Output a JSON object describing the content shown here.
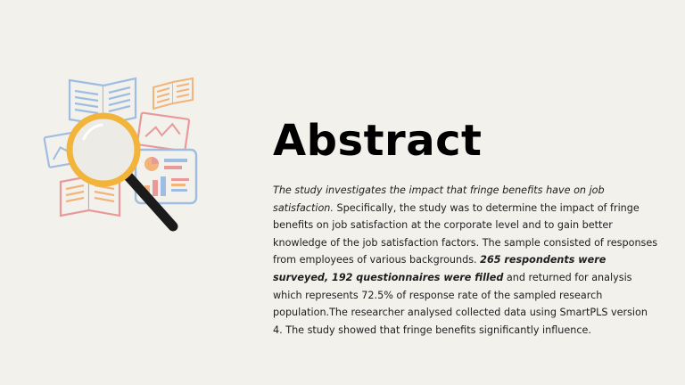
{
  "slide": {
    "title": "Abstract",
    "abstract": {
      "intro_italic": "The study investigates the impact that fringe benefits have on job satisfaction.",
      "part2": " Specifically, the study was to determine the impact of fringe benefits on job satisfaction at the corporate level and to gain better knowledge of the job satisfaction factors. The sample consisted of responses from employees of various backgrounds. ",
      "highlight_bold": "265 respondents were surveyed, 192 questionnaires were filled",
      "part3": " and returned for analysis which represents 72.5% of response rate of the sampled research population.The researcher analysed collected data using SmartPLS version 4. The study showed that fringe benefits significantly influence."
    }
  },
  "illustration": {
    "icon": "research-magnifier-icon",
    "colors": {
      "blue": "#9fbde0",
      "pink": "#e89a9a",
      "orange": "#f1b47a",
      "lens_ring": "#f2b43a",
      "handle": "#1b1b1b",
      "lens": "#ecebe6"
    }
  },
  "colors": {
    "background": "#f2f1ec",
    "text": "#1d1d1d",
    "title": "#000000"
  }
}
